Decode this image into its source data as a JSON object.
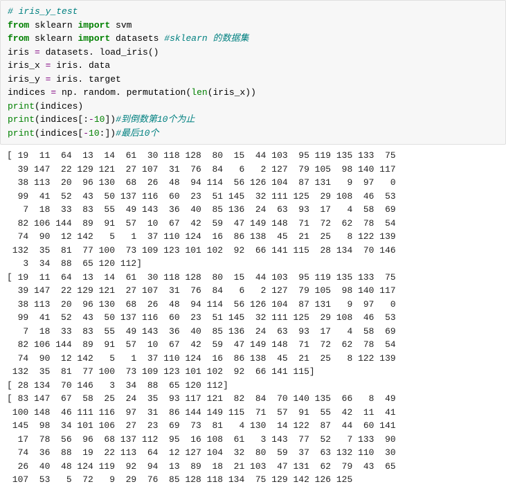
{
  "code": [
    {
      "kind": "comment",
      "text": "# iris_y_test"
    },
    {
      "kind": "line",
      "segments": [
        {
          "cls": "c-keyword",
          "text": "from "
        },
        {
          "cls": "c-module",
          "text": "sklearn "
        },
        {
          "cls": "c-keyword",
          "text": "import "
        },
        {
          "cls": "c-module",
          "text": "svm"
        }
      ]
    },
    {
      "kind": "line",
      "segments": [
        {
          "cls": "c-keyword",
          "text": "from "
        },
        {
          "cls": "c-module",
          "text": "sklearn "
        },
        {
          "cls": "c-keyword",
          "text": "import "
        },
        {
          "cls": "c-module",
          "text": "datasets "
        },
        {
          "cls": "c-commentzh",
          "text": "#sklearn 的数据集"
        }
      ]
    },
    {
      "kind": "line",
      "segments": [
        {
          "cls": "c-text",
          "text": "iris "
        },
        {
          "cls": "c-op",
          "text": "= "
        },
        {
          "cls": "c-text",
          "text": "datasets. load_iris"
        },
        {
          "cls": "c-paren",
          "text": "()"
        }
      ]
    },
    {
      "kind": "line",
      "segments": [
        {
          "cls": "c-text",
          "text": "iris_x "
        },
        {
          "cls": "c-op",
          "text": "= "
        },
        {
          "cls": "c-text",
          "text": "iris. data"
        }
      ]
    },
    {
      "kind": "line",
      "segments": [
        {
          "cls": "c-text",
          "text": "iris_y "
        },
        {
          "cls": "c-op",
          "text": "= "
        },
        {
          "cls": "c-text",
          "text": "iris. target"
        }
      ]
    },
    {
      "kind": "line",
      "segments": [
        {
          "cls": "c-text",
          "text": "indices "
        },
        {
          "cls": "c-op",
          "text": "= "
        },
        {
          "cls": "c-text",
          "text": "np. random. permutation"
        },
        {
          "cls": "c-paren",
          "text": "("
        },
        {
          "cls": "c-builtin",
          "text": "len"
        },
        {
          "cls": "c-paren",
          "text": "(iris_x))"
        }
      ]
    },
    {
      "kind": "line",
      "segments": [
        {
          "cls": "c-builtin",
          "text": "print"
        },
        {
          "cls": "c-paren",
          "text": "(indices)"
        }
      ]
    },
    {
      "kind": "line",
      "segments": [
        {
          "cls": "c-builtin",
          "text": "print"
        },
        {
          "cls": "c-paren",
          "text": "(indices[:"
        },
        {
          "cls": "c-op",
          "text": "-"
        },
        {
          "cls": "c-num",
          "text": "10"
        },
        {
          "cls": "c-paren",
          "text": "])"
        },
        {
          "cls": "c-commentzh",
          "text": "#到倒数第10个为止"
        }
      ]
    },
    {
      "kind": "line",
      "segments": [
        {
          "cls": "c-builtin",
          "text": "print"
        },
        {
          "cls": "c-paren",
          "text": "(indices["
        },
        {
          "cls": "c-op",
          "text": "-"
        },
        {
          "cls": "c-num",
          "text": "10"
        },
        {
          "cls": "c-paren",
          "text": ":])"
        },
        {
          "cls": "c-commentzh",
          "text": "#最后10个"
        }
      ]
    }
  ],
  "output": [
    "[ 19  11  64  13  14  61  30 118 128  80  15  44 103  95 119 135 133  75",
    "  39 147  22 129 121  27 107  31  76  84   6   2 127  79 105  98 140 117",
    "  38 113  20  96 130  68  26  48  94 114  56 126 104  87 131   9  97   0",
    "  99  41  52  43  50 137 116  60  23  51 145  32 111 125  29 108  46  53",
    "   7  18  33  83  55  49 143  36  40  85 136  24  63  93  17   4  58  69",
    "  82 106 144  89  91  57  10  67  42  59  47 149 148  71  72  62  78  54",
    "  74  90  12 142   5   1  37 110 124  16  86 138  45  21  25   8 122 139",
    " 132  35  81  77 100  73 109 123 101 102  92  66 141 115  28 134  70 146",
    "   3  34  88  65 120 112]",
    "[ 19  11  64  13  14  61  30 118 128  80  15  44 103  95 119 135 133  75",
    "  39 147  22 129 121  27 107  31  76  84   6   2 127  79 105  98 140 117",
    "  38 113  20  96 130  68  26  48  94 114  56 126 104  87 131   9  97   0",
    "  99  41  52  43  50 137 116  60  23  51 145  32 111 125  29 108  46  53",
    "   7  18  33  83  55  49 143  36  40  85 136  24  63  93  17   4  58  69",
    "  82 106 144  89  91  57  10  67  42  59  47 149 148  71  72  62  78  54",
    "  74  90  12 142   5   1  37 110 124  16  86 138  45  21  25   8 122 139",
    " 132  35  81  77 100  73 109 123 101 102  92  66 141 115]",
    "[ 28 134  70 146   3  34  88  65 120 112]",
    "[ 83 147  67  58  25  24  35  93 117 121  82  84  70 140 135  66   8  49",
    " 100 148  46 111 116  97  31  86 144 149 115  71  57  91  55  42  11  41",
    " 145  98  34 101 106  27  23  69  73  81   4 130  14 122  87  44  60 141",
    "  17  78  56  96  68 137 112  95  16 108  61   3 143  77  52   7 133  90",
    "  74  36  88  19  22 113  64  12 127 104  32  80  59  37  63 132 110  30",
    "  26  40  48 124 119  92  94  13  89  18  21 103  47 131  62  79  43  65",
    " 107  53   5  72   9  29  76  85 128 118 134  75 129 142 126 125"
  ]
}
